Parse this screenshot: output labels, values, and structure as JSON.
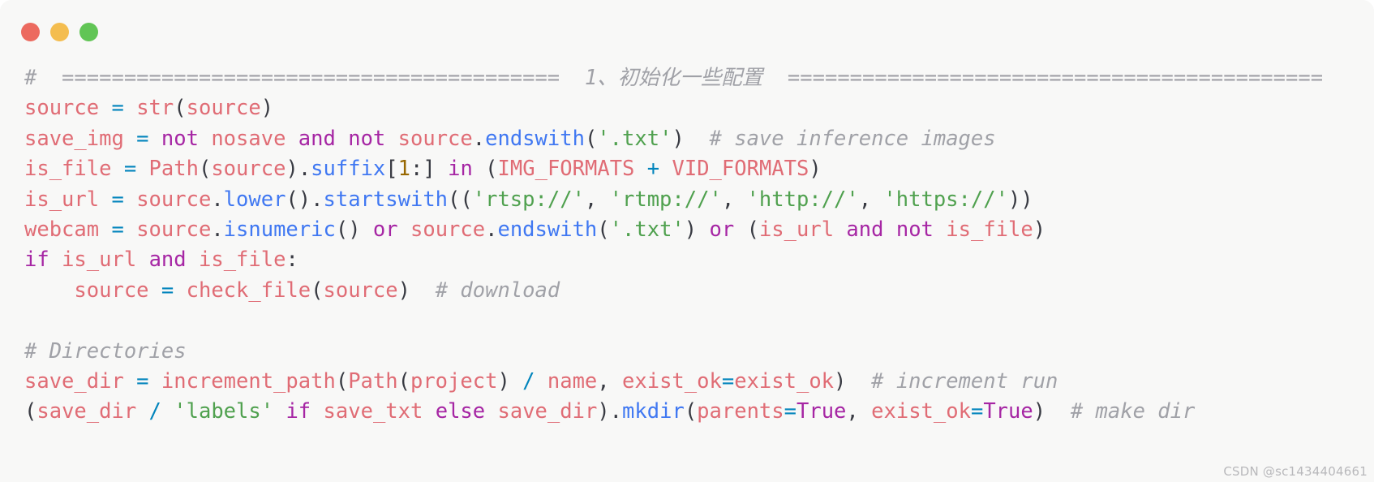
{
  "window": {
    "traffic_lights": [
      {
        "name": "close",
        "color": "#ec6a5f"
      },
      {
        "name": "minimize",
        "color": "#f4bd4f"
      },
      {
        "name": "zoom",
        "color": "#61c555"
      }
    ]
  },
  "theme": {
    "background": "#f8f8f7",
    "comment": "#a0a1a7",
    "identifier": "#e06c75",
    "keyword": "#a626a4",
    "function": "#4078f2",
    "string": "#50a14f",
    "number": "#986801",
    "operator": "#0184bc",
    "punctuation": "#383a42"
  },
  "watermark": "CSDN @sc1434404661",
  "code": {
    "language": "python",
    "lines": [
      {
        "id": "line-1-section-comment",
        "tokens": [
          {
            "t": "#  ========================================  1、初始化一些配置  ===========================================",
            "c": "cm"
          }
        ]
      },
      {
        "id": "line-2-source-str",
        "tokens": [
          {
            "t": "source ",
            "c": "id"
          },
          {
            "t": "=",
            "c": "op"
          },
          {
            "t": " ",
            "c": "pu"
          },
          {
            "t": "str",
            "c": "id"
          },
          {
            "t": "(",
            "c": "pu"
          },
          {
            "t": "source",
            "c": "id"
          },
          {
            "t": ")",
            "c": "pu"
          }
        ]
      },
      {
        "id": "line-3-save-img",
        "tokens": [
          {
            "t": "save_img ",
            "c": "id"
          },
          {
            "t": "=",
            "c": "op"
          },
          {
            "t": " ",
            "c": "pu"
          },
          {
            "t": "not",
            "c": "kw"
          },
          {
            "t": " ",
            "c": "pu"
          },
          {
            "t": "nosave",
            "c": "id"
          },
          {
            "t": " ",
            "c": "pu"
          },
          {
            "t": "and",
            "c": "kw"
          },
          {
            "t": " ",
            "c": "pu"
          },
          {
            "t": "not",
            "c": "kw"
          },
          {
            "t": " ",
            "c": "pu"
          },
          {
            "t": "source",
            "c": "id"
          },
          {
            "t": ".",
            "c": "pu"
          },
          {
            "t": "endswith",
            "c": "fn"
          },
          {
            "t": "(",
            "c": "pu"
          },
          {
            "t": "'.txt'",
            "c": "st"
          },
          {
            "t": ")",
            "c": "pu"
          },
          {
            "t": "  ",
            "c": "pu"
          },
          {
            "t": "# save inference images",
            "c": "cm"
          }
        ]
      },
      {
        "id": "line-4-is-file",
        "tokens": [
          {
            "t": "is_file ",
            "c": "id"
          },
          {
            "t": "=",
            "c": "op"
          },
          {
            "t": " ",
            "c": "pu"
          },
          {
            "t": "Path",
            "c": "id"
          },
          {
            "t": "(",
            "c": "pu"
          },
          {
            "t": "source",
            "c": "id"
          },
          {
            "t": ")",
            "c": "pu"
          },
          {
            "t": ".",
            "c": "pu"
          },
          {
            "t": "suffix",
            "c": "fn"
          },
          {
            "t": "[",
            "c": "pu"
          },
          {
            "t": "1",
            "c": "nu"
          },
          {
            "t": ":",
            "c": "pu"
          },
          {
            "t": "] ",
            "c": "pu"
          },
          {
            "t": "in",
            "c": "kw"
          },
          {
            "t": " (",
            "c": "pu"
          },
          {
            "t": "IMG_FORMATS",
            "c": "id"
          },
          {
            "t": " ",
            "c": "pu"
          },
          {
            "t": "+",
            "c": "op"
          },
          {
            "t": " ",
            "c": "pu"
          },
          {
            "t": "VID_FORMATS",
            "c": "id"
          },
          {
            "t": ")",
            "c": "pu"
          }
        ]
      },
      {
        "id": "line-5-is-url",
        "tokens": [
          {
            "t": "is_url ",
            "c": "id"
          },
          {
            "t": "=",
            "c": "op"
          },
          {
            "t": " ",
            "c": "pu"
          },
          {
            "t": "source",
            "c": "id"
          },
          {
            "t": ".",
            "c": "pu"
          },
          {
            "t": "lower",
            "c": "fn"
          },
          {
            "t": "().",
            "c": "pu"
          },
          {
            "t": "startswith",
            "c": "fn"
          },
          {
            "t": "((",
            "c": "pu"
          },
          {
            "t": "'rtsp://'",
            "c": "st"
          },
          {
            "t": ", ",
            "c": "pu"
          },
          {
            "t": "'rtmp://'",
            "c": "st"
          },
          {
            "t": ", ",
            "c": "pu"
          },
          {
            "t": "'http://'",
            "c": "st"
          },
          {
            "t": ", ",
            "c": "pu"
          },
          {
            "t": "'https://'",
            "c": "st"
          },
          {
            "t": "))",
            "c": "pu"
          }
        ]
      },
      {
        "id": "line-6-webcam",
        "tokens": [
          {
            "t": "webcam ",
            "c": "id"
          },
          {
            "t": "=",
            "c": "op"
          },
          {
            "t": " ",
            "c": "pu"
          },
          {
            "t": "source",
            "c": "id"
          },
          {
            "t": ".",
            "c": "pu"
          },
          {
            "t": "isnumeric",
            "c": "fn"
          },
          {
            "t": "() ",
            "c": "pu"
          },
          {
            "t": "or",
            "c": "kw"
          },
          {
            "t": " ",
            "c": "pu"
          },
          {
            "t": "source",
            "c": "id"
          },
          {
            "t": ".",
            "c": "pu"
          },
          {
            "t": "endswith",
            "c": "fn"
          },
          {
            "t": "(",
            "c": "pu"
          },
          {
            "t": "'.txt'",
            "c": "st"
          },
          {
            "t": ") ",
            "c": "pu"
          },
          {
            "t": "or",
            "c": "kw"
          },
          {
            "t": " (",
            "c": "pu"
          },
          {
            "t": "is_url",
            "c": "id"
          },
          {
            "t": " ",
            "c": "pu"
          },
          {
            "t": "and",
            "c": "kw"
          },
          {
            "t": " ",
            "c": "pu"
          },
          {
            "t": "not",
            "c": "kw"
          },
          {
            "t": " ",
            "c": "pu"
          },
          {
            "t": "is_file",
            "c": "id"
          },
          {
            "t": ")",
            "c": "pu"
          }
        ]
      },
      {
        "id": "line-7-if",
        "tokens": [
          {
            "t": "if",
            "c": "kw"
          },
          {
            "t": " ",
            "c": "pu"
          },
          {
            "t": "is_url",
            "c": "id"
          },
          {
            "t": " ",
            "c": "pu"
          },
          {
            "t": "and",
            "c": "kw"
          },
          {
            "t": " ",
            "c": "pu"
          },
          {
            "t": "is_file",
            "c": "id"
          },
          {
            "t": ":",
            "c": "pu"
          }
        ]
      },
      {
        "id": "line-8-check-file",
        "tokens": [
          {
            "t": "    source ",
            "c": "id"
          },
          {
            "t": "=",
            "c": "op"
          },
          {
            "t": " ",
            "c": "pu"
          },
          {
            "t": "check_file",
            "c": "id"
          },
          {
            "t": "(",
            "c": "pu"
          },
          {
            "t": "source",
            "c": "id"
          },
          {
            "t": ")",
            "c": "pu"
          },
          {
            "t": "  ",
            "c": "pu"
          },
          {
            "t": "# download",
            "c": "cm"
          }
        ]
      },
      {
        "id": "line-9-blank",
        "tokens": []
      },
      {
        "id": "line-10-directories-comment",
        "tokens": [
          {
            "t": "# Directories",
            "c": "cm"
          }
        ]
      },
      {
        "id": "line-11-save-dir",
        "tokens": [
          {
            "t": "save_dir ",
            "c": "id"
          },
          {
            "t": "=",
            "c": "op"
          },
          {
            "t": " ",
            "c": "pu"
          },
          {
            "t": "increment_path",
            "c": "id"
          },
          {
            "t": "(",
            "c": "pu"
          },
          {
            "t": "Path",
            "c": "id"
          },
          {
            "t": "(",
            "c": "pu"
          },
          {
            "t": "project",
            "c": "id"
          },
          {
            "t": ") ",
            "c": "pu"
          },
          {
            "t": "/",
            "c": "sl"
          },
          {
            "t": " ",
            "c": "pu"
          },
          {
            "t": "name",
            "c": "id"
          },
          {
            "t": ", ",
            "c": "pu"
          },
          {
            "t": "exist_ok",
            "c": "id"
          },
          {
            "t": "=",
            "c": "op"
          },
          {
            "t": "exist_ok",
            "c": "id"
          },
          {
            "t": ")",
            "c": "pu"
          },
          {
            "t": "  ",
            "c": "pu"
          },
          {
            "t": "# increment run",
            "c": "cm"
          }
        ]
      },
      {
        "id": "line-12-mkdir",
        "tokens": [
          {
            "t": "(",
            "c": "pu"
          },
          {
            "t": "save_dir",
            "c": "id"
          },
          {
            "t": " ",
            "c": "pu"
          },
          {
            "t": "/",
            "c": "sl"
          },
          {
            "t": " ",
            "c": "pu"
          },
          {
            "t": "'labels'",
            "c": "st"
          },
          {
            "t": " ",
            "c": "pu"
          },
          {
            "t": "if",
            "c": "kw"
          },
          {
            "t": " ",
            "c": "pu"
          },
          {
            "t": "save_txt",
            "c": "id"
          },
          {
            "t": " ",
            "c": "pu"
          },
          {
            "t": "else",
            "c": "kw"
          },
          {
            "t": " ",
            "c": "pu"
          },
          {
            "t": "save_dir",
            "c": "id"
          },
          {
            "t": ").",
            "c": "pu"
          },
          {
            "t": "mkdir",
            "c": "fn"
          },
          {
            "t": "(",
            "c": "pu"
          },
          {
            "t": "parents",
            "c": "id"
          },
          {
            "t": "=",
            "c": "op"
          },
          {
            "t": "True",
            "c": "kw"
          },
          {
            "t": ", ",
            "c": "pu"
          },
          {
            "t": "exist_ok",
            "c": "id"
          },
          {
            "t": "=",
            "c": "op"
          },
          {
            "t": "True",
            "c": "kw"
          },
          {
            "t": ")",
            "c": "pu"
          },
          {
            "t": "  ",
            "c": "pu"
          },
          {
            "t": "# make dir",
            "c": "cm"
          }
        ]
      }
    ]
  }
}
